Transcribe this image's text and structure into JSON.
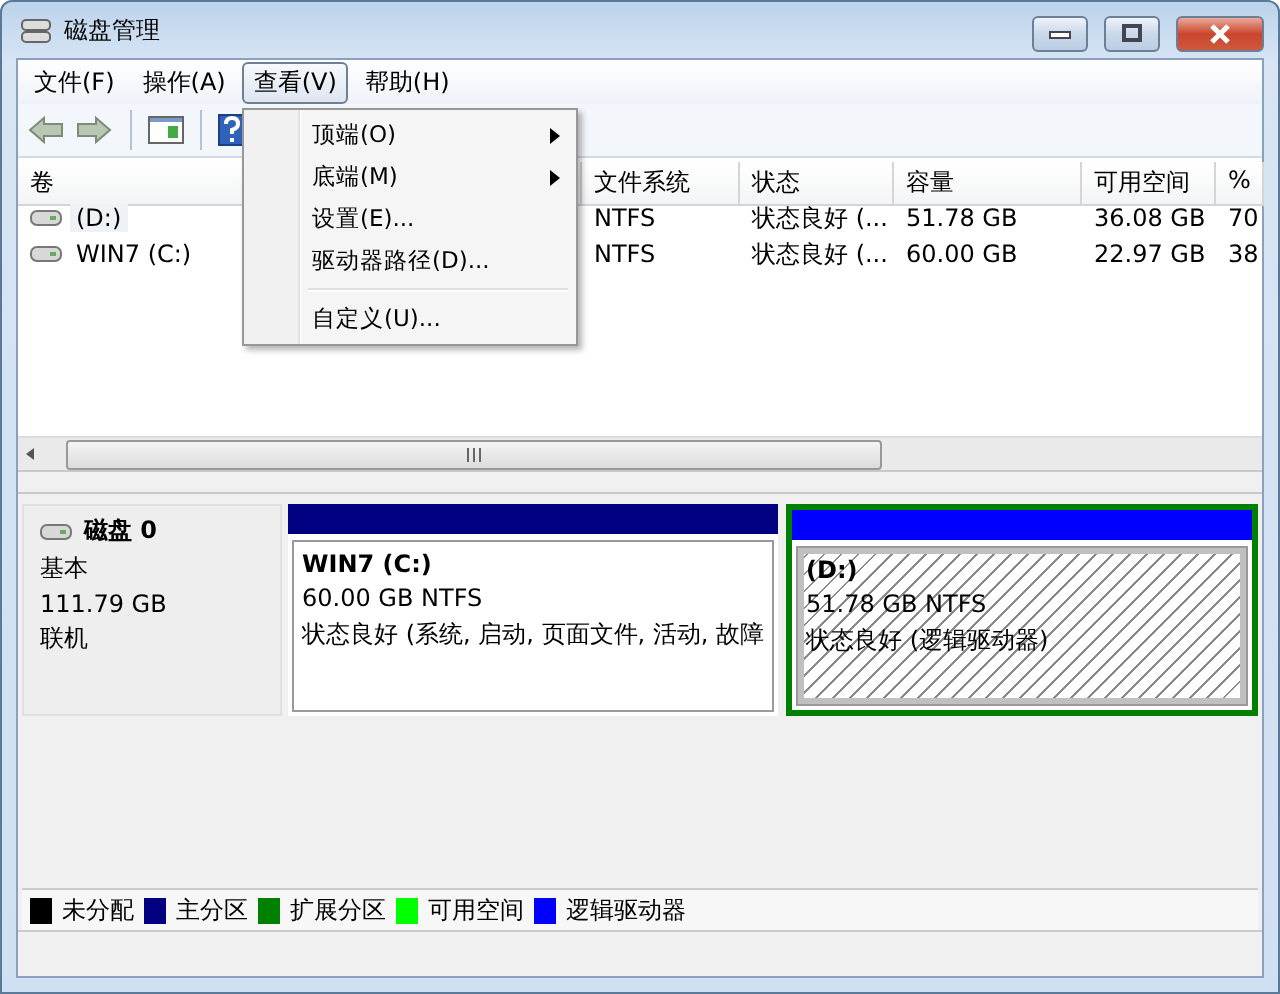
{
  "window": {
    "title": "磁盘管理"
  },
  "menu_bar": [
    {
      "label": "文件(F)",
      "selected": false
    },
    {
      "label": "操作(A)",
      "selected": false
    },
    {
      "label": "查看(V)",
      "selected": true
    },
    {
      "label": "帮助(H)",
      "selected": false
    }
  ],
  "open_menu": {
    "items": [
      {
        "kind": "item",
        "label": "顶端(O)",
        "has_submenu": true
      },
      {
        "kind": "item",
        "label": "底端(M)",
        "has_submenu": true
      },
      {
        "kind": "item",
        "label": "设置(E)...",
        "has_submenu": false
      },
      {
        "kind": "item",
        "label": "驱动器路径(D)...",
        "has_submenu": false
      },
      {
        "kind": "separator"
      },
      {
        "kind": "item",
        "label": "自定义(U)...",
        "has_submenu": false
      }
    ]
  },
  "volume_table": {
    "columns": [
      "卷",
      "文件系统",
      "状态",
      "容量",
      "可用空间",
      "%"
    ],
    "rows": [
      {
        "selected": true,
        "cells": [
          "(D:)",
          "NTFS",
          "状态良好 (...",
          "51.78 GB",
          "36.08 GB",
          "70"
        ]
      },
      {
        "selected": false,
        "cells": [
          "WIN7 (C:)",
          "NTFS",
          "状态良好 (...",
          "60.00 GB",
          "22.97 GB",
          "38"
        ]
      }
    ]
  },
  "disk": {
    "name": "磁盘 0",
    "type": "基本",
    "size": "111.79 GB",
    "status": "联机",
    "partitions": [
      {
        "kind": "primary",
        "color": "#000080",
        "selected": false,
        "name": "WIN7",
        "letter": "(C:)",
        "size_fs": "60.00 GB NTFS",
        "status": "状态良好 (系统, 启动, 页面文件, 活动, 故障"
      },
      {
        "kind": "logical",
        "color": "#0000ff",
        "selected": true,
        "letter": "(D:)",
        "size_fs": "51.78 GB NTFS",
        "status": "状态良好 (逻辑驱动器)"
      }
    ]
  },
  "legend": [
    {
      "label": "未分配",
      "color": "#000000"
    },
    {
      "label": "主分区",
      "color": "#000080"
    },
    {
      "label": "扩展分区",
      "color": "#008000"
    },
    {
      "label": "可用空间",
      "color": "#00ff00"
    },
    {
      "label": "逻辑驱动器",
      "color": "#0000ff"
    }
  ]
}
